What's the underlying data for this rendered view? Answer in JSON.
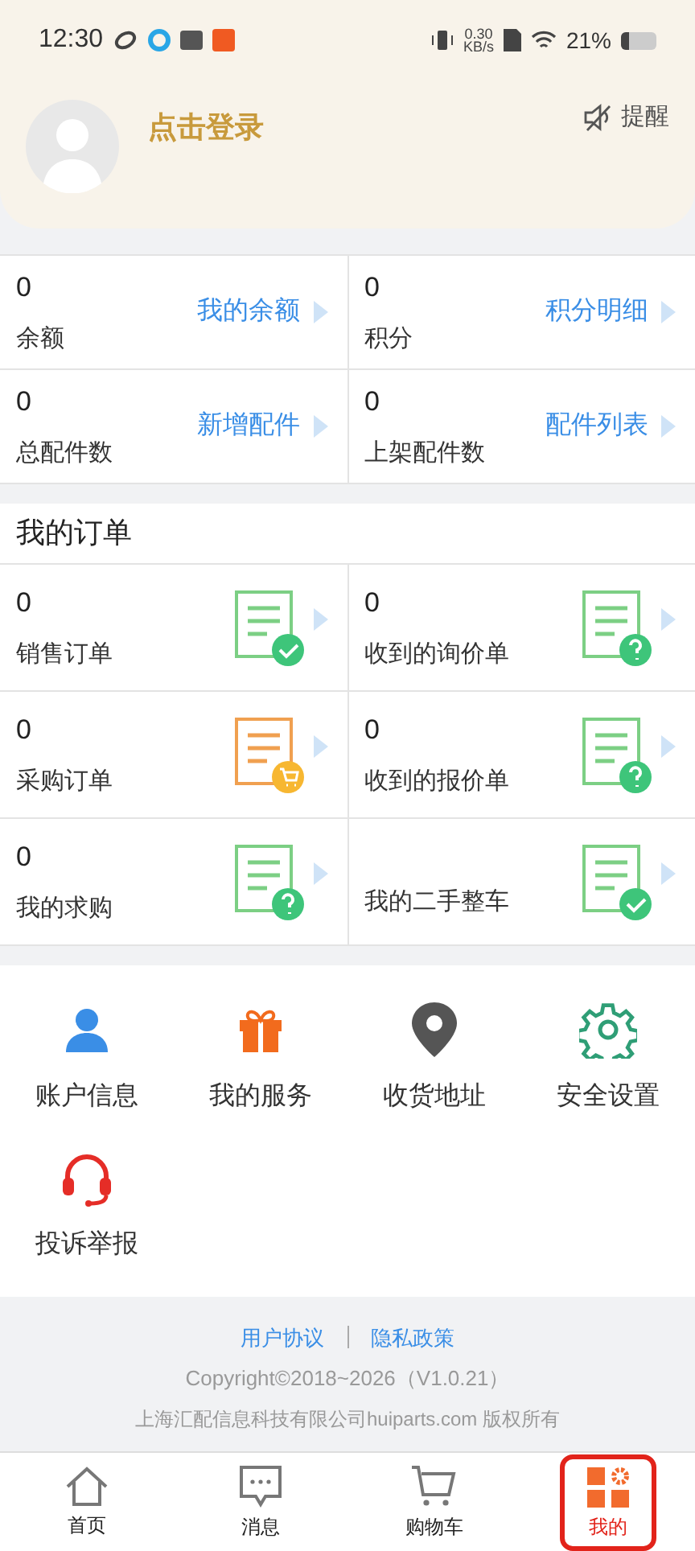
{
  "status_bar": {
    "time": "12:30",
    "speed_value": "0.30",
    "speed_unit": "KB/s",
    "battery": "21%"
  },
  "profile": {
    "login": "点击登录",
    "remind": "提醒"
  },
  "stats": [
    {
      "value": "0",
      "label": "余额",
      "link": "我的余额"
    },
    {
      "value": "0",
      "label": "积分",
      "link": "积分明细"
    },
    {
      "value": "0",
      "label": "总配件数",
      "link": "新增配件"
    },
    {
      "value": "0",
      "label": "上架配件数",
      "link": "配件列表"
    }
  ],
  "orders": {
    "title": "我的订单",
    "items": [
      {
        "value": "0",
        "label": "销售订单",
        "kind": "check",
        "color": "#7ccf84"
      },
      {
        "value": "0",
        "label": "收到的询价单",
        "kind": "question",
        "color": "#7ccf84"
      },
      {
        "value": "0",
        "label": "采购订单",
        "kind": "cart",
        "color": "#f0a050"
      },
      {
        "value": "0",
        "label": "收到的报价单",
        "kind": "question",
        "color": "#7ccf84"
      },
      {
        "value": "0",
        "label": "我的求购",
        "kind": "question",
        "color": "#7ccf84"
      },
      {
        "label": "我的二手整车",
        "kind": "check",
        "color": "#7ccf84"
      }
    ]
  },
  "services": [
    {
      "kind": "user",
      "label": "账户信息"
    },
    {
      "kind": "gift",
      "label": "我的服务"
    },
    {
      "kind": "pin",
      "label": "收货地址"
    },
    {
      "kind": "gear",
      "label": "安全设置"
    },
    {
      "kind": "headset",
      "label": "投诉举报"
    }
  ],
  "footer": {
    "links": [
      "用户协议",
      "隐私政策"
    ],
    "copyright": "Copyright©2018~2026（V1.0.21）",
    "company": "上海汇配信息科技有限公司huiparts.com 版权所有"
  },
  "tabs": [
    {
      "kind": "home",
      "label": "首页",
      "selected": false
    },
    {
      "kind": "chat",
      "label": "消息",
      "selected": false
    },
    {
      "kind": "cart",
      "label": "购物车",
      "selected": false
    },
    {
      "kind": "grid",
      "label": "我的",
      "selected": true
    }
  ]
}
